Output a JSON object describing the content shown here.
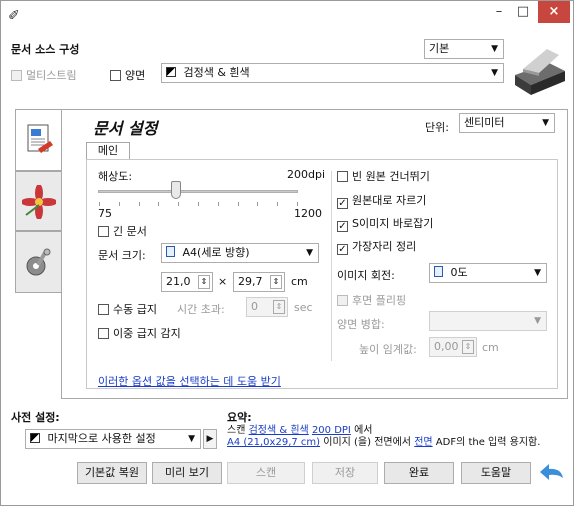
{
  "window": {
    "close_glyph": "×",
    "min_glyph": "–",
    "max_glyph": "□",
    "app_icon": "✐"
  },
  "source": {
    "heading": "문서 소스 구성",
    "preset_value": "기본",
    "multistream_label": "멀티스트림",
    "duplex_label": "양면",
    "color_mode_value": "검정색 & 흰색"
  },
  "left_tabs": [
    {
      "name": "document-settings-icon"
    },
    {
      "name": "image-enhance-icon"
    },
    {
      "name": "device-settings-icon"
    }
  ],
  "settings": {
    "title": "문서 설정",
    "unit_label": "단위:",
    "unit_value": "센티미터",
    "tab_main": "메인",
    "resolution_label": "해상도:",
    "resolution_value": "200dpi",
    "resolution_min": "75",
    "resolution_max": "1200",
    "resolution_fraction": 0.39,
    "long_doc_label": "긴 문서",
    "doc_size_label": "문서 크기:",
    "doc_size_value": "A4(세로 방향)",
    "width_value": "21,0",
    "height_value": "29,7",
    "times": "×",
    "unit_cm": "cm",
    "manual_feed_label": "수동 급지",
    "timeout_label": "시간 초과:",
    "timeout_value": "0",
    "timeout_unit": "sec",
    "double_feed_label": "이중 급지 감지",
    "help_link": "이러한 옵션 값을 선택하는 데 도움 받기",
    "skip_blank_label": "빈 원본 건너뛰기",
    "crop_label": "원본대로 자르기",
    "deskew_label": "S이미지 바로잡기",
    "edge_clean_label": "가장자리 정리",
    "rotate_label": "이미지 회전:",
    "rotate_value": "0도",
    "flip_label": "후면 플리핑",
    "merge_label": "양면 병합:",
    "merge_value": "",
    "height_threshold_label": "높이 임계값:",
    "height_threshold_value": "0,00",
    "height_threshold_unit": "cm"
  },
  "presets": {
    "heading": "사전 설정:",
    "value": "마지막으로 사용한 설정",
    "play_glyph": "▶"
  },
  "summary": {
    "heading": "요약:",
    "line1_prefix": "스캔",
    "line1_link1": "검정색 & 흰색",
    "line1_link2": "200 DPI",
    "line1_suffix": "에서",
    "line2_link1": "A4 (21,0x29,7 cm)",
    "line2_mid": "이미지 (을) 전면에서",
    "line2_link2": "전면",
    "line2_suffix": "ADF의 the 입력 용지함."
  },
  "buttons": {
    "reset": "기본값 복원",
    "preview": "미리 보기",
    "scan": "스캔",
    "save": "저장",
    "done": "완료",
    "help": "도움말"
  }
}
